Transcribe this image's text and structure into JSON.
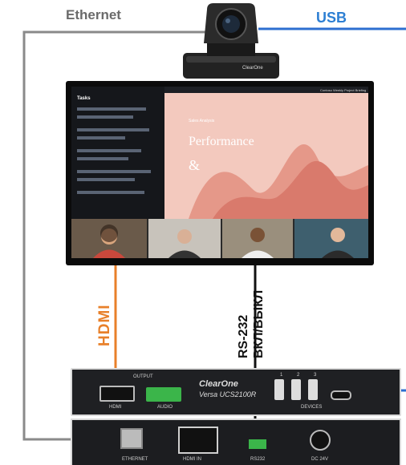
{
  "labels": {
    "ethernet": "Ethernet",
    "usb": "USB",
    "hdmi": "HDMI",
    "rs232_line1": "RS-232",
    "rs232_line2": "ВКЛ/ВЫКЛ"
  },
  "camera": {
    "brand": "ClearOne"
  },
  "screen": {
    "meeting_title": "Contoso Weekly Project Briefing",
    "tasks_title": "Tasks",
    "slide_title": "Sales Analysis",
    "slide_heading": "Performance",
    "slide_amp": "&"
  },
  "device_top": {
    "brand": "ClearOne",
    "model": "Versa UCS2100R",
    "output": "OUTPUT",
    "hdmi": "HDMI",
    "audio": "AUDIO",
    "devices": "DEVICES",
    "ports": [
      "1",
      "2",
      "3"
    ]
  },
  "device_bottom": {
    "ethernet": "ETHERNET",
    "hdmi_in": "HDMI IN",
    "rs232": "RS232",
    "dc": "DC 24V"
  },
  "colors": {
    "ethernet": "#8a8a8a",
    "usb": "#2d6fd0",
    "hdmi": "#e8802a",
    "rs232": "#111111"
  }
}
